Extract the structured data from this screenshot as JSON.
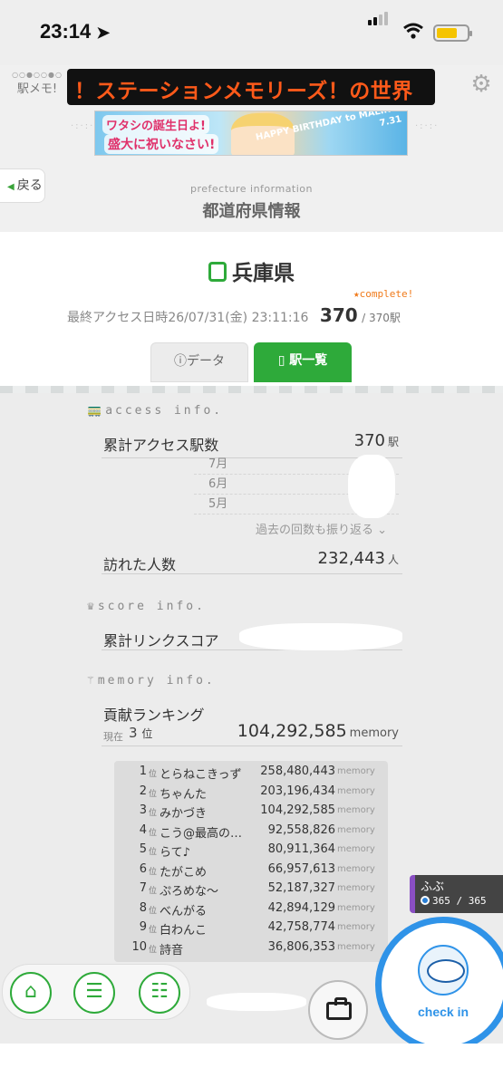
{
  "status_bar": {
    "time": "23:14"
  },
  "header": {
    "logo_text": "駅メモ!",
    "marquee": "！ステーションメモリーズ！の世界",
    "banner": {
      "line1": "ワタシの誕生日よ!",
      "line2": "盛大に祝いなさい!",
      "line3": "HAPPY BIRTHDAY to MALIN!!",
      "line4": "7.31"
    }
  },
  "page": {
    "back_label": "戻る",
    "subtitle": "prefecture information",
    "title": "都道府県情報"
  },
  "prefecture": {
    "name": "兵庫県",
    "complete_label": "complete!",
    "last_access_label": "最終アクセス日時",
    "last_access_value": "26/07/31(金) 23:11:16",
    "station_count": "370",
    "station_total": "/ 370駅",
    "tabs": {
      "data": "データ",
      "list": "駅一覧"
    }
  },
  "access_info": {
    "title": "access info.",
    "total_label": "累計アクセス駅数",
    "total_value": "370",
    "total_unit": "駅",
    "months": [
      "7月",
      "6月",
      "5月"
    ],
    "more_link": "過去の回数も振り返る",
    "visitors_label": "訪れた人数",
    "visitors_value": "232,443",
    "visitors_unit": "人"
  },
  "score_info": {
    "title": "score info.",
    "link_score_label": "累計リンクスコア"
  },
  "memory_info": {
    "title": "memory info.",
    "ranking_label": "貢献ランキング",
    "now_label": "現在",
    "now_rank": "3",
    "rank_unit": "位",
    "now_memory": "104,292,585",
    "memory_unit": "memory",
    "ranking": [
      {
        "rank": "1",
        "name": "とらねこきっず",
        "score": "258,480,443"
      },
      {
        "rank": "2",
        "name": "ちゃんた",
        "score": "203,196,434"
      },
      {
        "rank": "3",
        "name": "みかづき",
        "score": "104,292,585"
      },
      {
        "rank": "4",
        "name": "こう@最高の…",
        "score": "92,558,826"
      },
      {
        "rank": "5",
        "name": "らて♪",
        "score": "80,911,364"
      },
      {
        "rank": "6",
        "name": "たがこめ",
        "score": "66,957,613"
      },
      {
        "rank": "7",
        "name": "ぷろめな〜",
        "score": "52,187,327"
      },
      {
        "rank": "8",
        "name": "べんがる",
        "score": "42,894,129"
      },
      {
        "rank": "9",
        "name": "白わんこ",
        "score": "42,758,774"
      },
      {
        "rank": "10",
        "name": "詩音",
        "score": "36,806,353"
      }
    ]
  },
  "user": {
    "name": "ふぶ",
    "count": "365 / 365"
  },
  "checkin": {
    "label": "check in"
  },
  "colors": {
    "accent_green": "#2eaa3a",
    "checkin_blue": "#2f93e8",
    "marquee_orange": "#ff5a1a"
  }
}
